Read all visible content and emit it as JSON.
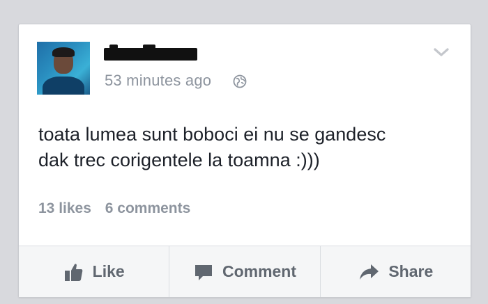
{
  "post": {
    "timestamp": "53 minutes ago",
    "text_line1": "toata lumea sunt boboci ei nu se gandesc",
    "text_line2": "dak trec corigentele la toamna :)))",
    "likes": "13 likes",
    "comments": "6 comments"
  },
  "actions": {
    "like_label": "Like",
    "comment_label": "Comment",
    "share_label": "Share"
  },
  "icons": {
    "globe": "globe-icon",
    "chevron": "chevron-down-icon",
    "like": "thumbs-up-icon",
    "comment": "speech-bubble-icon",
    "share": "share-arrow-icon"
  },
  "colors": {
    "background": "#d8d9dd",
    "card": "#ffffff",
    "meta_text": "#8d949e",
    "body_text": "#1d2129",
    "action_text": "#606770"
  }
}
